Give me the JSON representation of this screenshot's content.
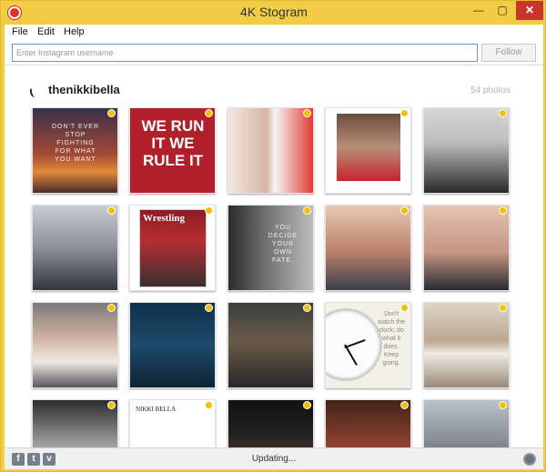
{
  "window": {
    "title": "4K Stogram",
    "minimize": "—",
    "maximize": "▢",
    "close": "✕"
  },
  "menu": {
    "file": "File",
    "edit": "Edit",
    "help": "Help"
  },
  "search": {
    "placeholder": "Enter Instagram username",
    "value": "",
    "follow_label": "Follow"
  },
  "profile": {
    "username": "thenikkibella",
    "photo_count": "54 photos"
  },
  "photos": {
    "p1_caption": "DON'T EVER STOP FIGHTING FOR WHAT YOU WANT",
    "p2_caption": "WE RUN IT WE RULE IT",
    "p7_caption": "Wrestling",
    "p8_caption": "YOU DECIDE YOUR OWN FATE.",
    "p14_caption": "Don't watch the clock; do what it does. Keep going.",
    "p17_caption": "NIKKI BELLA"
  },
  "status": {
    "text": "Updating..."
  },
  "icons": {
    "facebook": "f",
    "twitter": "t",
    "vimeo": "v"
  },
  "colors": {
    "frame": "#f3cc45",
    "close": "#c7352d",
    "input_border": "#6e98c8"
  }
}
